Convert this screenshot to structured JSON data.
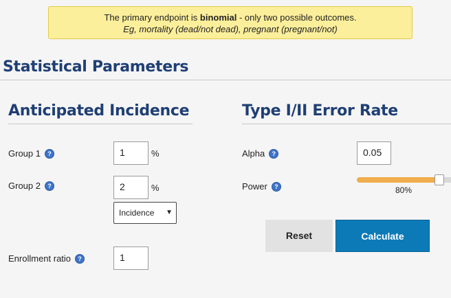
{
  "notice": {
    "line1_prefix": "The primary endpoint is ",
    "line1_bold": "binomial",
    "line1_suffix": " - only two possible outcomes.",
    "line2": "Eg, mortality (dead/not dead), pregnant (pregnant/not)"
  },
  "headings": {
    "main": "Statistical Parameters",
    "incidence": "Anticipated Incidence",
    "error_rate": "Type I/II Error Rate"
  },
  "incidence": {
    "group1_label": "Group 1",
    "group1_value": "1",
    "group1_unit": "%",
    "group2_label": "Group 2",
    "group2_value": "2",
    "group2_unit": "%",
    "mode_selected": "Incidence",
    "enrollment_label": "Enrollment ratio",
    "enrollment_value": "1"
  },
  "error_rate": {
    "alpha_label": "Alpha",
    "alpha_value": "0.05",
    "power_label": "Power",
    "power_value_text": "80%",
    "power_fraction": 0.8
  },
  "buttons": {
    "reset": "Reset",
    "calculate": "Calculate"
  },
  "help_glyph": "?",
  "colors": {
    "heading": "#1f3f74",
    "notice_bg": "#fcef9b",
    "slider_fill": "#f0ad4e",
    "calculate_bg": "#0d7ab8",
    "help_icon": "#3f74c8"
  },
  "icons": {
    "help": "question-circle-icon",
    "select": "chevron-down-icon"
  }
}
